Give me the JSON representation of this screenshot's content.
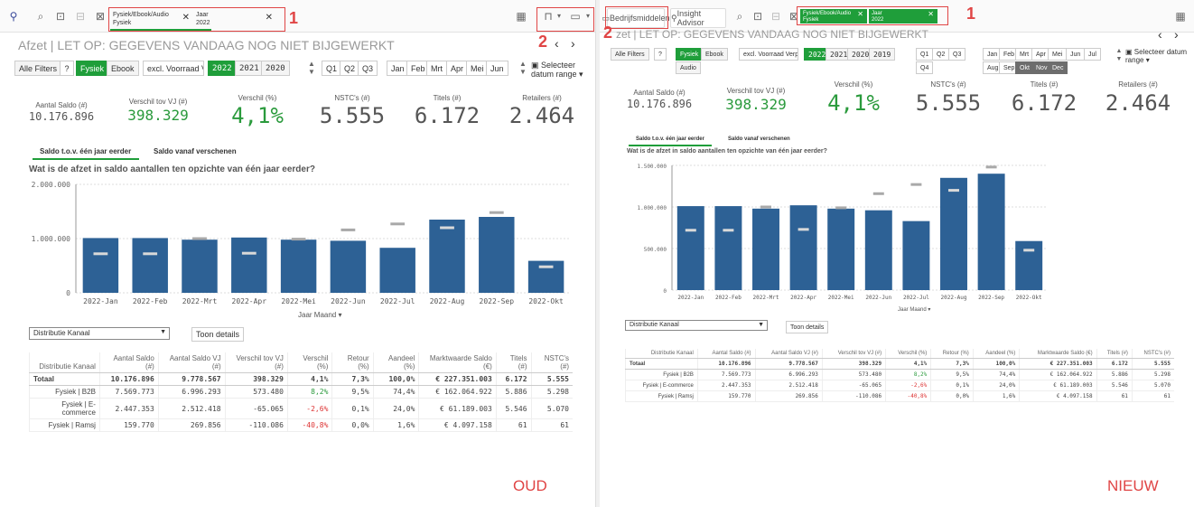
{
  "left": {
    "toolbar": {
      "filter_label": "Fysiek/Ebook/Audio",
      "filter_value": "Fysiek",
      "year_label": "Jaar",
      "year_value": "2022"
    },
    "annot_1": "1",
    "annot_2": "2",
    "title": "Afzet | LET OP: GEGEVENS VANDAAG NOG NIET BIJGEWERKT",
    "filters": {
      "all": "Alle Filters",
      "fysiek": "Fysiek",
      "ebook": "Ebook",
      "excl": "excl. Voorraad Ve",
      "years": [
        "2022",
        "2021",
        "2020"
      ],
      "quarters": [
        "Q1",
        "Q2",
        "Q3"
      ],
      "months": [
        "Jan",
        "Feb",
        "Mrt",
        "Apr",
        "Mei",
        "Jun"
      ],
      "range": "Selecteer datum range"
    },
    "kpis": [
      {
        "label": "Aantal Saldo (#)",
        "value": "10.176.896"
      },
      {
        "label": "Verschil tov VJ (#)",
        "value": "398.329"
      },
      {
        "label": "Verschil (%)",
        "value": "4,1%"
      },
      {
        "label": "NSTC's (#)",
        "value": "5.555"
      },
      {
        "label": "Titels (#)",
        "value": "6.172"
      },
      {
        "label": "Retailers (#)",
        "value": "2.464"
      }
    ],
    "tabs": [
      "Saldo t.o.v. één jaar eerder",
      "Saldo vanaf verschenen"
    ],
    "chart_title": "Wat is de afzet in saldo aantallen ten opzichte van één jaar eerder?",
    "x_label": "Jaar Maand",
    "dropdown": "Distributie Kanaal",
    "details": "Toon details",
    "table": {
      "headers": [
        "Distributie Kanaal",
        "Aantal Saldo (#)",
        "Aantal Saldo VJ (#)",
        "Verschil tov VJ (#)",
        "Verschil (%)",
        "Retour (%)",
        "Aandeel (%)",
        "Marktwaarde Saldo (€)",
        "Titels (#)",
        "NSTC's (#)"
      ],
      "total": [
        "Totaal",
        "10.176.896",
        "9.778.567",
        "398.329",
        "4,1%",
        "7,3%",
        "100,0%",
        "€ 227.351.003",
        "6.172",
        "5.555"
      ],
      "rows": [
        [
          "Fysiek | B2B",
          "7.569.773",
          "6.996.293",
          "573.480",
          "8,2%",
          "9,5%",
          "74,4%",
          "€ 162.064.922",
          "5.886",
          "5.298"
        ],
        [
          "Fysiek | E-commerce",
          "2.447.353",
          "2.512.418",
          "-65.065",
          "-2,6%",
          "0,1%",
          "24,0%",
          "€ 61.189.003",
          "5.546",
          "5.070"
        ],
        [
          "Fysiek | Ramsj",
          "159.770",
          "269.856",
          "-110.086",
          "-40,8%",
          "0,0%",
          "1,6%",
          "€ 4.097.158",
          "61",
          "61"
        ]
      ]
    },
    "stamp": "OUD"
  },
  "right": {
    "toolbar": {
      "sheet": "Bedrijfsmiddelen",
      "insight": "Insight Advisor",
      "filter_label": "Fysiek/Ebook/Audio",
      "filter_value": "Fysiek",
      "year_label": "Jaar",
      "year_value": "2022"
    },
    "annot_1": "1",
    "annot_2": "2",
    "title": "zet | LET OP: GEGEVENS VANDAAG NOG NIET BIJGEWERKT",
    "filters": {
      "all": "Alle Filters",
      "fysiek": "Fysiek",
      "ebook": "Ebook",
      "audio": "Audio",
      "excl": "excl. Voorraad Verplt",
      "years": [
        "2022",
        "2021",
        "2020",
        "2019"
      ],
      "quarters": [
        "Q1",
        "Q2",
        "Q3",
        "Q4"
      ],
      "months": [
        "Jan",
        "Feb",
        "Mrt",
        "Apr",
        "Mei",
        "Jun",
        "Jul",
        "Aug",
        "Sep",
        "Okt",
        "Nov",
        "Dec"
      ],
      "range": "Selecteer datum range"
    },
    "kpis": [
      {
        "label": "Aantal Saldo (#)",
        "value": "10.176.896"
      },
      {
        "label": "Verschil tov VJ (#)",
        "value": "398.329"
      },
      {
        "label": "Verschil (%)",
        "value": "4,1%"
      },
      {
        "label": "NSTC's (#)",
        "value": "5.555"
      },
      {
        "label": "Titels (#)",
        "value": "6.172"
      },
      {
        "label": "Retailers (#)",
        "value": "2.464"
      }
    ],
    "tabs": [
      "Saldo t.o.v. één jaar eerder",
      "Saldo vanaf verschenen"
    ],
    "chart_title": "Wat is de afzet in saldo aantallen ten opzichte van één jaar eerder?",
    "x_label": "Jaar Maand",
    "dropdown": "Distributie Kanaal",
    "details": "Toon details",
    "table": {
      "headers": [
        "Distributie Kanaal",
        "Aantal Saldo (#)",
        "Aantal Saldo VJ (#)",
        "Verschil tov VJ (#)",
        "Verschil (%)",
        "Retour (%)",
        "Aandeel (%)",
        "Marktwaarde Saldo (€)",
        "Titels (#)",
        "NSTC's (#)"
      ],
      "total": [
        "Totaal",
        "10.176.896",
        "9.778.567",
        "398.329",
        "4,1%",
        "7,3%",
        "100,0%",
        "€ 227.351.003",
        "6.172",
        "5.555"
      ],
      "rows": [
        [
          "Fysiek | B2B",
          "7.569.773",
          "6.996.293",
          "573.480",
          "8,2%",
          "9,5%",
          "74,4%",
          "€ 162.064.922",
          "5.886",
          "5.298"
        ],
        [
          "Fysiek | E-commerce",
          "2.447.353",
          "2.512.418",
          "-65.065",
          "-2,6%",
          "0,1%",
          "24,0%",
          "€ 61.189.003",
          "5.546",
          "5.070"
        ],
        [
          "Fysiek | Ramsj",
          "159.770",
          "269.856",
          "-110.086",
          "-40,8%",
          "0,0%",
          "1,6%",
          "€ 4.097.158",
          "61",
          "61"
        ]
      ]
    },
    "stamp": "NIEUW"
  },
  "chart_data": [
    {
      "type": "bar",
      "categories": [
        "2022-Jan",
        "2022-Feb",
        "2022-Mrt",
        "2022-Apr",
        "2022-Mei",
        "2022-Jun",
        "2022-Jul",
        "2022-Aug",
        "2022-Sep",
        "2022-Okt"
      ],
      "series": [
        {
          "values": [
            1010000,
            1010000,
            980000,
            1020000,
            980000,
            960000,
            830000,
            1350000,
            1400000,
            590000
          ]
        },
        {
          "values": [
            720000,
            720000,
            1000000,
            730000,
            990000,
            1160000,
            1270000,
            1200000,
            1480000,
            480000
          ]
        }
      ],
      "yticks": [
        "0",
        "1.000.000",
        "2.000.000"
      ],
      "ylim": [
        0,
        2000000
      ],
      "xlabel": "Jaar Maand"
    },
    {
      "type": "bar",
      "categories": [
        "2022-Jan",
        "2022-Feb",
        "2022-Mrt",
        "2022-Apr",
        "2022-Mei",
        "2022-Jun",
        "2022-Jul",
        "2022-Aug",
        "2022-Sep",
        "2022-Okt"
      ],
      "series": [
        {
          "values": [
            1010000,
            1010000,
            980000,
            1020000,
            980000,
            960000,
            830000,
            1350000,
            1400000,
            590000
          ]
        },
        {
          "values": [
            720000,
            720000,
            1000000,
            730000,
            990000,
            1160000,
            1270000,
            1200000,
            1480000,
            480000
          ]
        }
      ],
      "yticks": [
        "0",
        "500.000",
        "1.000.000",
        "1.500.000"
      ],
      "ylim": [
        0,
        1500000
      ],
      "xlabel": "Jaar Maand"
    }
  ],
  "colors": {
    "accent_green": "#1f9e3a",
    "bar": "#2d6195",
    "annotation_red": "#e04545"
  }
}
